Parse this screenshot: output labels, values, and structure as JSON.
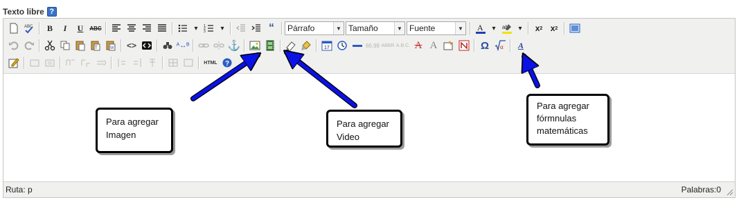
{
  "field": {
    "label": "Texto libre",
    "help_icon": "help-icon"
  },
  "toolbar": {
    "format_select": "Párrafo",
    "size_select": "Tamaño",
    "font_select": "Fuente",
    "html_button": "HTML",
    "colors": {
      "font_color_bar": "#1f3fb5",
      "highlight_bar": "#f2e200"
    }
  },
  "status": {
    "path": "Ruta: p",
    "words": "Palabras:0"
  },
  "annotations": {
    "image": "Para agregar\nImagen",
    "video": "Para agregar\nVideo",
    "formulas": "Para agregar\nfórmnulas\nmatemáticas",
    "arrow_color": "#0a12e6"
  }
}
